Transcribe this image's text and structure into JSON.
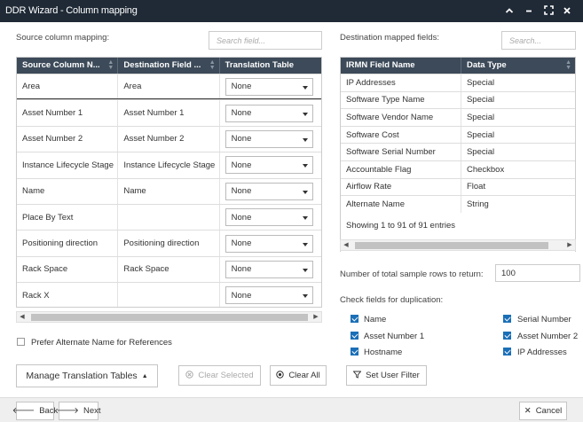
{
  "window": {
    "title": "DDR Wizard - Column mapping"
  },
  "source": {
    "label": "Source column mapping:",
    "search_placeholder": "Search field...",
    "columns": [
      "Source Column N...",
      "Destination Field ...",
      "Translation Table"
    ],
    "rows": [
      {
        "source": "Area",
        "destination": "Area",
        "translation": "None"
      },
      {
        "source": "Asset Number 1",
        "destination": "Asset Number 1",
        "translation": "None"
      },
      {
        "source": "Asset Number 2",
        "destination": "Asset Number 2",
        "translation": "None"
      },
      {
        "source": "Instance Lifecycle Stage",
        "destination": "Instance Lifecycle Stage",
        "translation": "None"
      },
      {
        "source": "Name",
        "destination": "Name",
        "translation": "None"
      },
      {
        "source": "Place By Text",
        "destination": "",
        "translation": "None"
      },
      {
        "source": "Positioning direction",
        "destination": "Positioning direction",
        "translation": "None"
      },
      {
        "source": "Rack Space",
        "destination": "Rack Space",
        "translation": "None"
      },
      {
        "source": "Rack X",
        "destination": "",
        "translation": "None"
      }
    ],
    "prefer_alternate_label": "Prefer Alternate Name for References"
  },
  "destination": {
    "label": "Destination mapped fields:",
    "search_placeholder": "Search...",
    "columns": [
      "IRMN Field Name",
      "Data Type"
    ],
    "rows": [
      {
        "field": "IP Addresses",
        "type": "Special"
      },
      {
        "field": "Software Type Name",
        "type": "Special"
      },
      {
        "field": "Software Vendor Name",
        "type": "Special"
      },
      {
        "field": "Software Cost",
        "type": "Special"
      },
      {
        "field": "Software Serial Number",
        "type": "Special"
      },
      {
        "field": "Accountable Flag",
        "type": "Checkbox"
      },
      {
        "field": "Airflow Rate",
        "type": "Float"
      },
      {
        "field": "Alternate Name",
        "type": "String"
      }
    ],
    "entries_info": "Showing 1 to 91 of 91 entries"
  },
  "sample_rows": {
    "label": "Number of total sample rows to return:",
    "value": "100"
  },
  "duplication": {
    "label": "Check fields for duplication:",
    "left": [
      {
        "label": "Name",
        "checked": true
      },
      {
        "label": "Asset Number 1",
        "checked": true
      },
      {
        "label": "Hostname",
        "checked": true
      }
    ],
    "right": [
      {
        "label": "Serial Number",
        "checked": true
      },
      {
        "label": "Asset Number 2",
        "checked": true
      },
      {
        "label": "IP Addresses",
        "checked": true
      }
    ]
  },
  "actions": {
    "manage": "Manage Translation Tables",
    "clear_selected": "Clear Selected",
    "clear_all": "Clear All",
    "set_user_filter": "Set User Filter"
  },
  "footer": {
    "back": "Back",
    "next": "Next",
    "cancel": "Cancel"
  },
  "icons": {
    "collapse": "chevron-up-icon",
    "minimize": "minimize-icon",
    "maximize": "maximize-icon",
    "close": "close-icon"
  }
}
